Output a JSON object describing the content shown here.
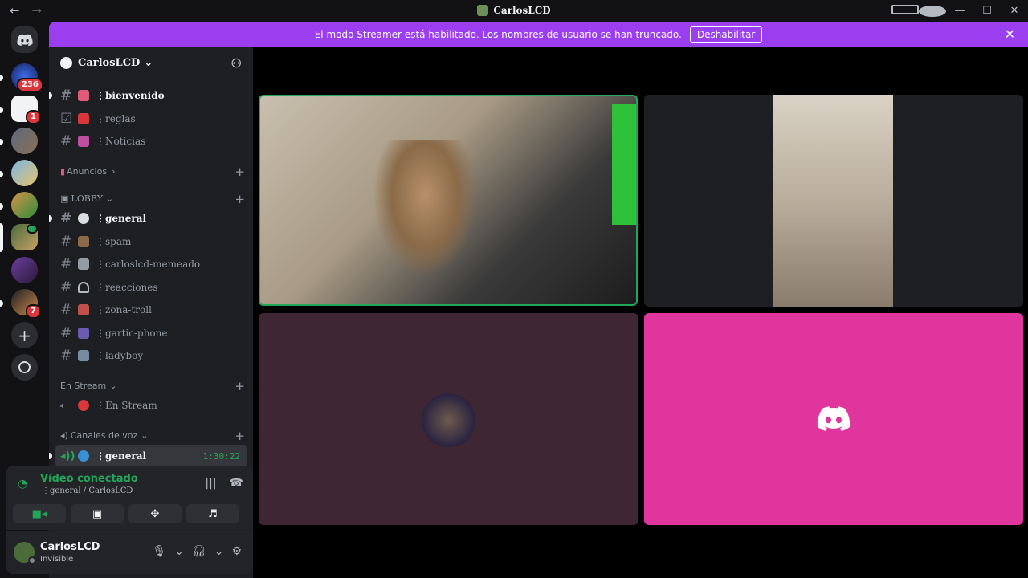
{
  "window": {
    "title": "CarlosLCD",
    "nav_back": "←",
    "nav_forward": "→",
    "minimize": "—",
    "maximize": "☐",
    "close": "✕"
  },
  "servers": [
    {
      "badge": "236"
    },
    {
      "badge": "1"
    },
    {
      "badge": ""
    },
    {
      "badge": ""
    },
    {
      "badge": ""
    },
    {
      "badge": ""
    },
    {
      "badge": ""
    },
    {
      "badge": "7"
    }
  ],
  "banner": {
    "text": "El modo Streamer está habilitado. Los nombres de usuario se han truncado.",
    "button": "Deshabilitar",
    "close": "✕"
  },
  "guild": {
    "name": "CarlosLCD",
    "chevron": "⌄"
  },
  "channels": {
    "top": [
      {
        "name": "⋮bienvenido",
        "bold": true
      },
      {
        "name": "⋮reglas",
        "bold": false
      },
      {
        "name": "⋮Noticias",
        "bold": false
      }
    ],
    "cat_anuncios": "Anuncios",
    "cat_lobby": "LOBBY",
    "lobby": [
      {
        "name": "⋮general",
        "bold": true
      },
      {
        "name": "⋮spam"
      },
      {
        "name": "⋮carloslcd-memeado"
      },
      {
        "name": "⋮reacciones"
      },
      {
        "name": "⋮zona-troll"
      },
      {
        "name": "⋮gartic-phone"
      },
      {
        "name": "⋮ladyboy"
      }
    ],
    "cat_stream": "En Stream",
    "stream": [
      {
        "name": "⋮En Stream"
      }
    ],
    "cat_voz": "Canales de voz",
    "voz": [
      {
        "name": "⋮general",
        "time": "1:30:22"
      }
    ]
  },
  "voice": {
    "status": "Vídeo conectado",
    "sub": "⋮general / CarlosLCD"
  },
  "user": {
    "name": "CarlosLCD",
    "status": "Invisible"
  }
}
